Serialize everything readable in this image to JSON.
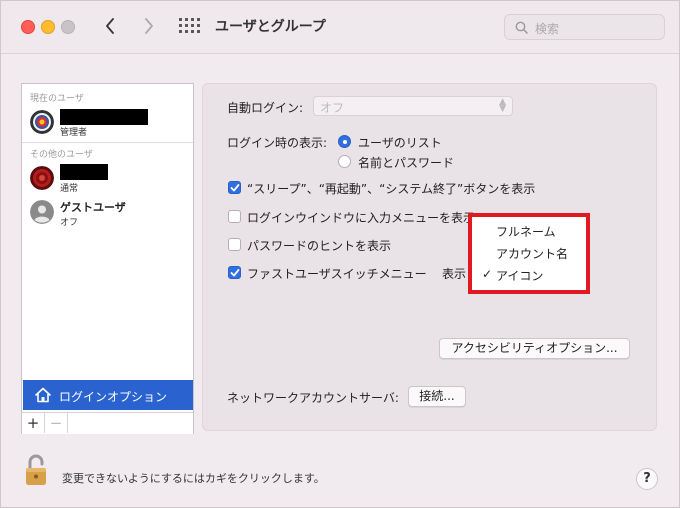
{
  "window": {
    "title": "ユーザとグループ"
  },
  "search": {
    "placeholder": "検索"
  },
  "sidebar": {
    "current_section": "現在のユーザ",
    "other_section": "その他のユーザ",
    "current_user": {
      "name": "",
      "role": "管理者"
    },
    "other_users": [
      {
        "name": "",
        "role": "通常"
      },
      {
        "name": "ゲストユーザ",
        "role": "オフ"
      }
    ],
    "login_options": "ログインオプション",
    "add": "+",
    "remove": "−"
  },
  "panel": {
    "auto_login_label": "自動ログイン:",
    "auto_login_value": "オフ",
    "display_label": "ログイン時の表示:",
    "radio_list": "ユーザのリスト",
    "radio_name_pw": "名前とパスワード",
    "cb_sleep": "“スリープ”、“再起動”、“システム終了”ボタンを表示",
    "cb_input_menu": "ログインウインドウに入力メニューを表示",
    "cb_hint": "パスワードのヒントを表示",
    "cb_fast_switch": "ファストユーザスイッチメニュー",
    "fast_switch_display": "表示",
    "accessibility_btn": "アクセシビリティオプション...",
    "network_label": "ネットワークアカウントサーバ:",
    "connect_btn": "接続..."
  },
  "menu": {
    "items": [
      "フルネーム",
      "アカウント名",
      "アイコン"
    ],
    "checkmark": "✓"
  },
  "footer": {
    "lock_text": "変更できないようにするにはカギをクリックします。",
    "help": "?"
  },
  "colors": {
    "accent": "#2f6fe2",
    "highlight_box": "#e01a22",
    "sidebar_selected": "#2a62cf"
  }
}
